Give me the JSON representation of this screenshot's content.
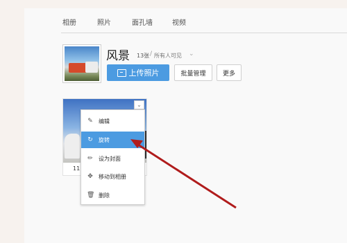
{
  "tabs": [
    "相册",
    "照片",
    "面孔墙",
    "视频"
  ],
  "album": {
    "title": "风景",
    "count": "13张",
    "visibility": "所有人可见",
    "sep": "/"
  },
  "buttons": {
    "upload": "上传照片",
    "batch": "批量管理",
    "more": "更多"
  },
  "photo": {
    "caption": "11"
  },
  "menu": [
    {
      "label": "编辑",
      "icon": "pencil-icon"
    },
    {
      "label": "旋转",
      "icon": "rotate-icon"
    },
    {
      "label": "设为封面",
      "icon": "cover-icon"
    },
    {
      "label": "移动到相册",
      "icon": "move-icon"
    },
    {
      "label": "删除",
      "icon": "trash-icon"
    }
  ],
  "colors": {
    "accent": "#4c9be1",
    "arrow": "#b01c1c"
  }
}
